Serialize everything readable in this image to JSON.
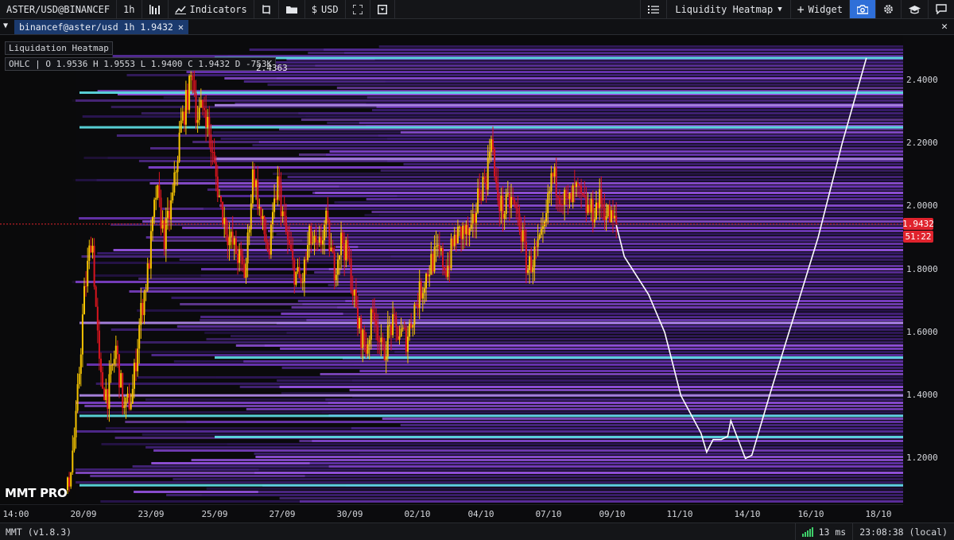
{
  "toolbar": {
    "symbol": "ASTER/USD@BINANCEF",
    "interval": "1h",
    "indicators_label": "Indicators",
    "currency_label": "USD",
    "layout_label": "Liquidity Heatmap",
    "widget_label": "Widget",
    "icons": [
      "candles-icon",
      "indicators-icon",
      "crop-icon",
      "folder-icon",
      "dollar-icon",
      "fullscreen-icon",
      "dropdown-icon",
      "list-icon",
      "plus-icon",
      "camera-icon",
      "gear-icon",
      "academy-icon",
      "chat-icon"
    ]
  },
  "tab": {
    "label": "binancef@aster/usd 1h 1.9432",
    "close": "✕"
  },
  "legend": {
    "indicator_name": "Liquidation Heatmap",
    "ohlc": "OHLC | O 1.9536 H 1.9553 L 1.9400 C 1.9432 D -753K"
  },
  "brand": "MMT PRO",
  "price": {
    "current": "1.9432",
    "countdown": "51:22",
    "peak_label": "2.4363",
    "peak": 2.4363,
    "current_value": 1.9432
  },
  "colors": {
    "accent": "#2f6fd8",
    "price_tag": "#e0232d",
    "candle_up": "#f5c400",
    "candle_down": "#d9141e",
    "heat_low": "#3a1e6e",
    "heat_mid": "#8f50d8",
    "heat_high": "#5fe3ea",
    "projection": "#ffffff"
  },
  "status": {
    "version": "MMT (v1.8.3)",
    "latency": "13 ms",
    "clock": "23:08:38 (local)"
  },
  "chart_data": {
    "type": "heatmap",
    "title": "Liquidation Heatmap",
    "symbol": "ASTER/USD",
    "y_ticks": [
      "1.2000",
      "1.4000",
      "1.6000",
      "1.8000",
      "2.0000",
      "2.2000",
      "2.4000"
    ],
    "y_values": [
      1.2,
      1.4,
      1.6,
      1.8,
      2.0,
      2.2,
      2.4
    ],
    "ylim": [
      1.06,
      2.51
    ],
    "x_ticks": [
      "14:00",
      "20/09",
      "23/09",
      "25/09",
      "27/09",
      "30/09",
      "02/10",
      "04/10",
      "07/10",
      "09/10",
      "11/10",
      "14/10",
      "16/10",
      "18/10"
    ],
    "price_path": [
      {
        "t": 0.0,
        "p": 1.1
      },
      {
        "t": 0.01,
        "p": 1.3
      },
      {
        "t": 0.02,
        "p": 1.7
      },
      {
        "t": 0.03,
        "p": 1.92
      },
      {
        "t": 0.04,
        "p": 1.45
      },
      {
        "t": 0.05,
        "p": 1.4
      },
      {
        "t": 0.06,
        "p": 1.55
      },
      {
        "t": 0.07,
        "p": 1.35
      },
      {
        "t": 0.08,
        "p": 1.4
      },
      {
        "t": 0.09,
        "p": 1.65
      },
      {
        "t": 0.1,
        "p": 1.8
      },
      {
        "t": 0.11,
        "p": 2.05
      },
      {
        "t": 0.12,
        "p": 1.9
      },
      {
        "t": 0.13,
        "p": 2.02
      },
      {
        "t": 0.14,
        "p": 2.25
      },
      {
        "t": 0.15,
        "p": 2.36
      },
      {
        "t": 0.155,
        "p": 2.43
      },
      {
        "t": 0.16,
        "p": 2.28
      },
      {
        "t": 0.17,
        "p": 2.32
      },
      {
        "t": 0.18,
        "p": 2.15
      },
      {
        "t": 0.19,
        "p": 2.0
      },
      {
        "t": 0.2,
        "p": 1.9
      },
      {
        "t": 0.21,
        "p": 1.85
      },
      {
        "t": 0.22,
        "p": 1.78
      },
      {
        "t": 0.23,
        "p": 2.12
      },
      {
        "t": 0.24,
        "p": 1.95
      },
      {
        "t": 0.25,
        "p": 1.85
      },
      {
        "t": 0.26,
        "p": 2.08
      },
      {
        "t": 0.27,
        "p": 1.92
      },
      {
        "t": 0.28,
        "p": 1.8
      },
      {
        "t": 0.29,
        "p": 1.75
      },
      {
        "t": 0.3,
        "p": 1.9
      },
      {
        "t": 0.31,
        "p": 1.85
      },
      {
        "t": 0.32,
        "p": 1.95
      },
      {
        "t": 0.33,
        "p": 1.8
      },
      {
        "t": 0.34,
        "p": 1.9
      },
      {
        "t": 0.35,
        "p": 1.8
      },
      {
        "t": 0.36,
        "p": 1.62
      },
      {
        "t": 0.37,
        "p": 1.55
      },
      {
        "t": 0.38,
        "p": 1.68
      },
      {
        "t": 0.39,
        "p": 1.52
      },
      {
        "t": 0.4,
        "p": 1.62
      },
      {
        "t": 0.41,
        "p": 1.6
      },
      {
        "t": 0.42,
        "p": 1.58
      },
      {
        "t": 0.43,
        "p": 1.68
      },
      {
        "t": 0.44,
        "p": 1.75
      },
      {
        "t": 0.45,
        "p": 1.82
      },
      {
        "t": 0.46,
        "p": 1.85
      },
      {
        "t": 0.47,
        "p": 1.8
      },
      {
        "t": 0.48,
        "p": 1.9
      },
      {
        "t": 0.49,
        "p": 1.92
      },
      {
        "t": 0.5,
        "p": 1.9
      },
      {
        "t": 0.51,
        "p": 2.05
      },
      {
        "t": 0.52,
        "p": 2.1
      },
      {
        "t": 0.525,
        "p": 2.25
      },
      {
        "t": 0.53,
        "p": 2.05
      },
      {
        "t": 0.54,
        "p": 1.98
      },
      {
        "t": 0.55,
        "p": 2.02
      },
      {
        "t": 0.56,
        "p": 1.95
      },
      {
        "t": 0.57,
        "p": 1.8
      },
      {
        "t": 0.58,
        "p": 1.85
      },
      {
        "t": 0.59,
        "p": 1.9
      },
      {
        "t": 0.6,
        "p": 2.1
      },
      {
        "t": 0.61,
        "p": 2.05
      },
      {
        "t": 0.62,
        "p": 2.0
      },
      {
        "t": 0.63,
        "p": 2.05
      },
      {
        "t": 0.64,
        "p": 2.0
      },
      {
        "t": 0.65,
        "p": 1.98
      },
      {
        "t": 0.66,
        "p": 2.02
      },
      {
        "t": 0.67,
        "p": 1.97
      },
      {
        "t": 0.68,
        "p": 1.94
      }
    ],
    "projection": [
      {
        "t": 0.68,
        "p": 1.94
      },
      {
        "t": 0.69,
        "p": 1.84
      },
      {
        "t": 0.72,
        "p": 1.72
      },
      {
        "t": 0.74,
        "p": 1.6
      },
      {
        "t": 0.76,
        "p": 1.4
      },
      {
        "t": 0.785,
        "p": 1.28
      },
      {
        "t": 0.792,
        "p": 1.22
      },
      {
        "t": 0.8,
        "p": 1.26
      },
      {
        "t": 0.81,
        "p": 1.26
      },
      {
        "t": 0.818,
        "p": 1.27
      },
      {
        "t": 0.822,
        "p": 1.32
      },
      {
        "t": 0.828,
        "p": 1.28
      },
      {
        "t": 0.84,
        "p": 1.2
      },
      {
        "t": 0.848,
        "p": 1.21
      },
      {
        "t": 0.87,
        "p": 1.4
      },
      {
        "t": 0.9,
        "p": 1.65
      },
      {
        "t": 0.93,
        "p": 1.9
      },
      {
        "t": 0.96,
        "p": 2.2
      },
      {
        "t": 0.99,
        "p": 2.47
      }
    ],
    "bright_levels": [
      1.115,
      1.268,
      1.335,
      1.52,
      2.25,
      2.32,
      2.36,
      2.47,
      1.63,
      2.15,
      1.4
    ],
    "grid": false,
    "legend": "none"
  }
}
